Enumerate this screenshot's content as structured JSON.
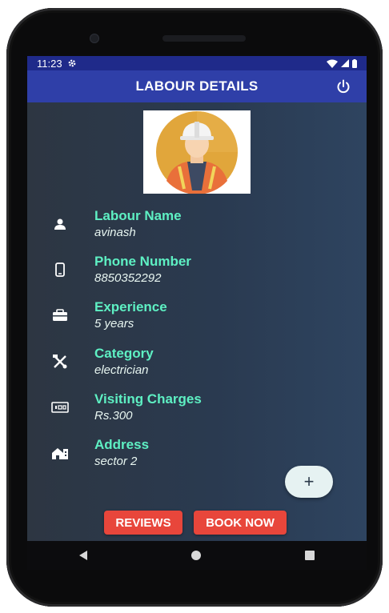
{
  "status_bar": {
    "time": "11:23"
  },
  "app_bar": {
    "title": "LABOUR DETAILS"
  },
  "details": [
    {
      "icon": "person-icon",
      "label": "Labour Name",
      "value": "avinash"
    },
    {
      "icon": "phone-icon",
      "label": "Phone Number",
      "value": "8850352292"
    },
    {
      "icon": "briefcase-icon",
      "label": "Experience",
      "value": "5 years"
    },
    {
      "icon": "tools-icon",
      "label": "Category",
      "value": "electrician"
    },
    {
      "icon": "money-icon",
      "label": "Visiting Charges",
      "value": "Rs.300"
    },
    {
      "icon": "home-icon",
      "label": "Address",
      "value": "sector 2"
    }
  ],
  "fab": {
    "label": "+"
  },
  "buttons": {
    "reviews": "REVIEWS",
    "book_now": "BOOK NOW"
  },
  "colors": {
    "app_bar": "#2f3fa8",
    "accent_text": "#5ef0c3",
    "button": "#e8463b"
  }
}
